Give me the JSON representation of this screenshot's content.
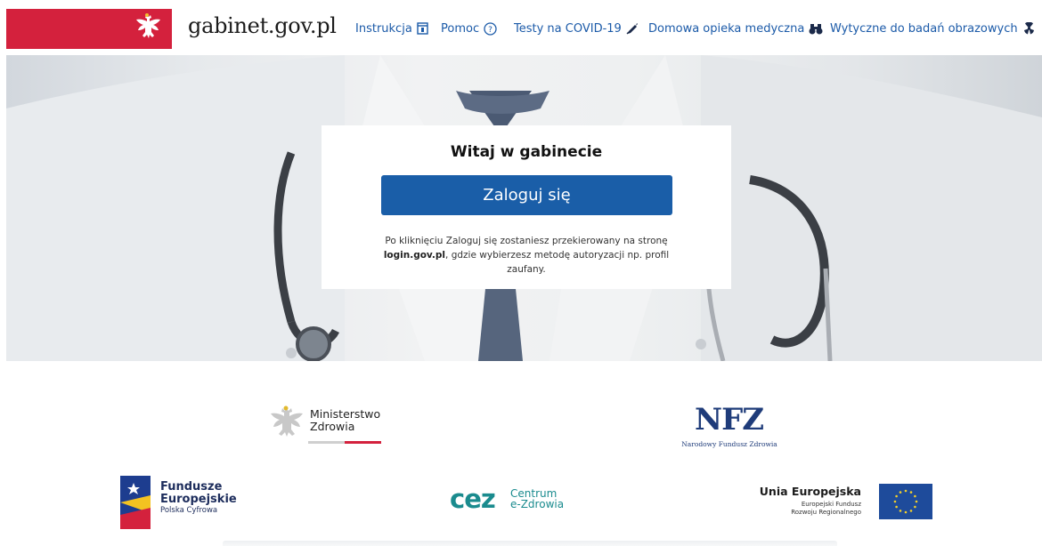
{
  "header": {
    "site_title": "gabinet.gov.pl",
    "nav": [
      {
        "label": "Instrukcja",
        "icon": "book-icon"
      },
      {
        "label": "Pomoc",
        "icon": "help-circle-icon"
      },
      {
        "label": "Testy na COVID-19",
        "icon": "syringe-icon"
      },
      {
        "label": "Domowa opieka medyczna",
        "icon": "binoculars-icon"
      },
      {
        "label": "Wytyczne do badań obrazowych",
        "icon": "radiation-icon"
      }
    ],
    "flag_color": "#d4213d",
    "link_color": "#1b5aa8"
  },
  "login_card": {
    "title": "Witaj w gabinecie",
    "button_label": "Zaloguj się",
    "note_part1": "Po kliknięciu Zaloguj się zostaniesz przekierowany na stronę",
    "note_bold": "login.gov.pl",
    "note_part2": ", gdzie wybierzesz metodę autoryzacji np. profil zaufany.",
    "button_color": "#1a5ea8"
  },
  "footer_logos": {
    "ministry": {
      "line1": "Ministerstwo",
      "line2": "Zdrowia"
    },
    "nfz": {
      "mark": "NFZ",
      "subtitle": "Narodowy Fundusz Zdrowia"
    },
    "funds": {
      "line1": "Fundusze",
      "line2": "Europejskie",
      "line3": "Polska Cyfrowa"
    },
    "cez": {
      "mark": "cez",
      "line1": "Centrum",
      "line2": "e-Zdrowia"
    },
    "eu": {
      "line1": "Unia Europejska",
      "line2": "Europejski Fundusz",
      "line3": "Rozwoju Regionalnego"
    }
  }
}
